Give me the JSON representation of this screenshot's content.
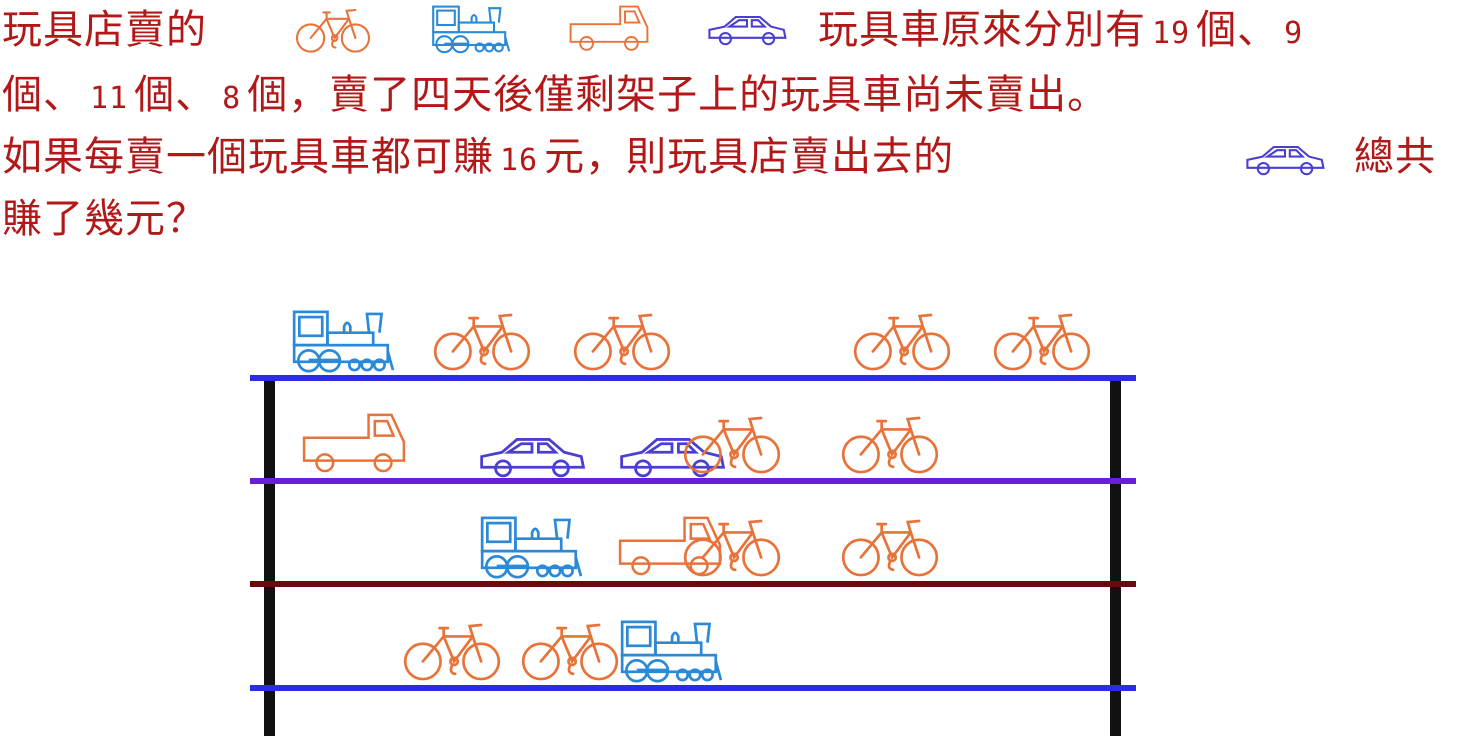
{
  "question": {
    "l1_a": "玩具店賣的",
    "l1_b": "玩具車原來分別有",
    "n_bike": "19",
    "l1_c": "個、",
    "n_train": "9",
    "l2_a": "個、",
    "n_truck": "11",
    "l2_b": "個、",
    "n_car": "8",
    "l2_c": "個，賣了四天後僅剩架子上的玩具車尚未賣出。",
    "l3_a": "如果每賣一個玩具車都可賺",
    "n_profit": "16",
    "l3_b": "元，則玩具店賣出去的",
    "l3_c": "總共",
    "l4": "賺了幾元？"
  },
  "question_icons": [
    "bicycle-icon",
    "train-icon",
    "truck-icon",
    "car-icon"
  ],
  "shelves": [
    {
      "color": "#2b2be8",
      "items": [
        "train",
        "bicycle",
        "bicycle",
        "",
        "bicycle",
        "bicycle"
      ]
    },
    {
      "color": "#6a1fd6",
      "items": [
        "truck",
        "car",
        "car",
        "bicycle",
        "bicycle"
      ]
    },
    {
      "color": "#6b0a0a",
      "items": [
        "",
        "train",
        "truck",
        "bicycle",
        "bicycle"
      ]
    },
    {
      "color": "#2b2be8",
      "items": [
        "bicycle",
        "bicycle",
        "train"
      ]
    }
  ],
  "colors": {
    "text": "#b31818",
    "bicycle": "#e8733a",
    "train": "#2a8ad8",
    "truck": "#e8733a",
    "car": "#4a3fd0",
    "post": "#111111"
  }
}
